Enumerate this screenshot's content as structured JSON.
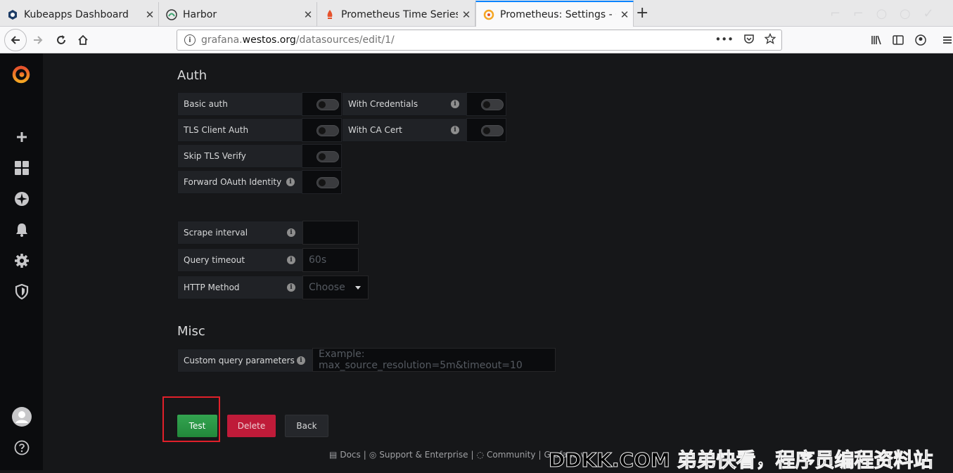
{
  "browser": {
    "tabs": [
      {
        "label": "Kubeapps Dashboard",
        "icon": "kubeapps-icon"
      },
      {
        "label": "Harbor",
        "icon": "harbor-icon"
      },
      {
        "label": "Prometheus Time Series C",
        "icon": "prometheus-icon"
      },
      {
        "label": "Prometheus: Settings - G",
        "icon": "grafana-icon"
      }
    ],
    "close_glyph": "✕",
    "new_tab_glyph": "+",
    "url": {
      "pre": "grafana.",
      "host": "westos.org",
      "post": "/datasources/edit/1/"
    },
    "url_menu": "•••"
  },
  "auth": {
    "title": "Auth",
    "basic_auth": "Basic auth",
    "with_credentials": "With Credentials",
    "tls_client_auth": "TLS Client Auth",
    "with_ca_cert": "With CA Cert",
    "skip_tls_verify": "Skip TLS Verify",
    "forward_oauth": "Forward OAuth Identity"
  },
  "settings": {
    "scrape_interval": "Scrape interval",
    "scrape_interval_value": "",
    "query_timeout": "Query timeout",
    "query_timeout_placeholder": "60s",
    "http_method": "HTTP Method",
    "http_method_placeholder": "Choose"
  },
  "misc": {
    "title": "Misc",
    "custom_query": "Custom query parameters",
    "custom_query_placeholder": "Example: max_source_resolution=5m&timeout=10"
  },
  "buttons": {
    "test": "Test",
    "delete": "Delete",
    "back": "Back"
  },
  "footer": {
    "docs": "Docs",
    "support": "Support & Enterprise",
    "community": "Community",
    "version": "Grafana v"
  },
  "watermark": "DDKK.COM 弟弟快看，程序员编程资料站",
  "info_glyph": "i",
  "accent_color": "#0a84ff",
  "highlight_color": "#e0202a"
}
